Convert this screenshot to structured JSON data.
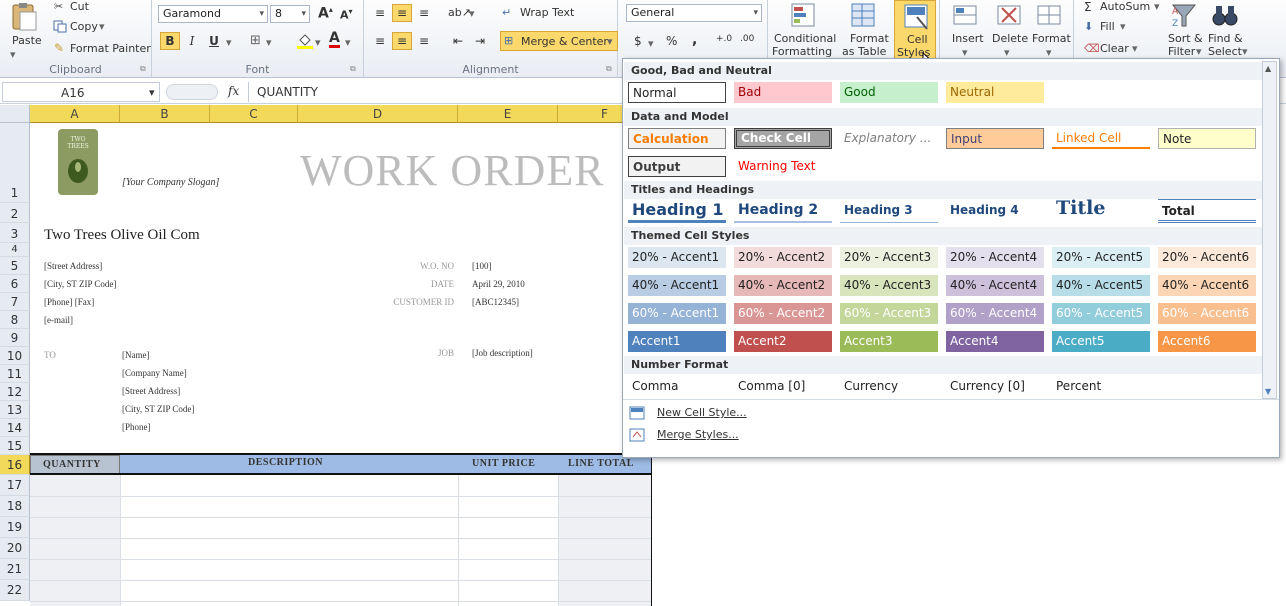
{
  "ribbon": {
    "clipboard": {
      "paste": "Paste",
      "cut": "Cut",
      "copy": "Copy",
      "format_painter": "Format Painter",
      "label": "Clipboard"
    },
    "font": {
      "name": "Garamond",
      "size": "8",
      "bold": "B",
      "italic": "I",
      "underline": "U",
      "label": "Font"
    },
    "alignment": {
      "wrap_text": "Wrap Text",
      "merge_center": "Merge & Center",
      "label": "Alignment"
    },
    "number": {
      "format": "General",
      "currency": "$",
      "percent": "%",
      "comma": ",",
      "inc_decimal": "+.0",
      "dec_decimal": ".00",
      "label": ""
    },
    "styles": {
      "conditional_l1": "Conditional",
      "conditional_l2": "Formatting",
      "format_table_l1": "Format",
      "format_table_l2": "as Table",
      "cell_styles_l1": "Cell",
      "cell_styles_l2": "Styles"
    },
    "cells": {
      "insert": "Insert",
      "delete": "Delete",
      "format": "Format"
    },
    "editing": {
      "autosum": "AutoSum",
      "fill": "Fill",
      "clear": "Clear",
      "sort_l1": "Sort &",
      "sort_l2": "Filter",
      "find_l1": "Find &",
      "find_l2": "Select"
    }
  },
  "formula_bar": {
    "name_box": "A16",
    "fx": "fx",
    "value": "QUANTITY"
  },
  "sheet": {
    "columns": [
      "A",
      "B",
      "C",
      "D",
      "E",
      "F"
    ],
    "rows": [
      "1",
      "2",
      "3",
      "4",
      "5",
      "6",
      "7",
      "8",
      "9",
      "10",
      "11",
      "12",
      "13",
      "14",
      "15",
      "16",
      "17",
      "18",
      "19",
      "20",
      "21",
      "22"
    ],
    "logo_text": "TWO TREES",
    "slogan": "[Your Company Slogan]",
    "title": "WORK ORDER",
    "company": "Two Trees Olive Oil Com",
    "address_lines": [
      "[Street Address]",
      "[City, ST  ZIP Code]",
      "[Phone] [Fax]",
      "[e-mail]"
    ],
    "wo_label": "W.O. NO",
    "wo_value": "[100]",
    "date_label": "DATE",
    "date_value": "April 29, 2010",
    "cust_label": "CUSTOMER ID",
    "cust_value": "[ABC12345]",
    "to_label": "TO",
    "to_lines": [
      "[Name]",
      "[Company Name]",
      "[Street Address]",
      "[City, ST  ZIP Code]",
      "[Phone]"
    ],
    "job_label": "JOB",
    "job_value": "[Job description]",
    "table_headers": [
      "QUANTITY",
      "DESCRIPTION",
      "UNIT PRICE",
      "LINE TOTAL"
    ]
  },
  "gallery": {
    "sections": {
      "good_bad": "Good, Bad and Neutral",
      "data_model": "Data and Model",
      "titles": "Titles and Headings",
      "themed": "Themed Cell Styles",
      "number": "Number Format"
    },
    "good_bad": [
      "Normal",
      "Bad",
      "Good",
      "Neutral"
    ],
    "data_model_row1": [
      "Calculation",
      "Check Cell",
      "Explanatory ...",
      "Input",
      "Linked Cell",
      "Note"
    ],
    "data_model_row2": [
      "Output",
      "Warning Text"
    ],
    "titles": [
      "Heading 1",
      "Heading 2",
      "Heading 3",
      "Heading 4",
      "Title",
      "Total"
    ],
    "accent20": [
      "20% - Accent1",
      "20% - Accent2",
      "20% - Accent3",
      "20% - Accent4",
      "20% - Accent5",
      "20% - Accent6"
    ],
    "accent40": [
      "40% - Accent1",
      "40% - Accent2",
      "40% - Accent3",
      "40% - Accent4",
      "40% - Accent5",
      "40% - Accent6"
    ],
    "accent60": [
      "60% - Accent1",
      "60% - Accent2",
      "60% - Accent3",
      "60% - Accent4",
      "60% - Accent5",
      "60% - Accent6"
    ],
    "accent": [
      "Accent1",
      "Accent2",
      "Accent3",
      "Accent4",
      "Accent5",
      "Accent6"
    ],
    "number": [
      "Comma",
      "Comma [0]",
      "Currency",
      "Currency [0]",
      "Percent"
    ],
    "new_style": "New Cell Style...",
    "merge_styles": "Merge Styles..."
  },
  "colors": {
    "accent1": "#4f81bd",
    "accent2": "#c0504d",
    "accent3": "#9bbb59",
    "accent4": "#8064a2",
    "accent5": "#4bacc6",
    "accent6": "#f79646",
    "header_yellow": "#f3d95a",
    "table_header_blue": "#9dbbe4"
  }
}
